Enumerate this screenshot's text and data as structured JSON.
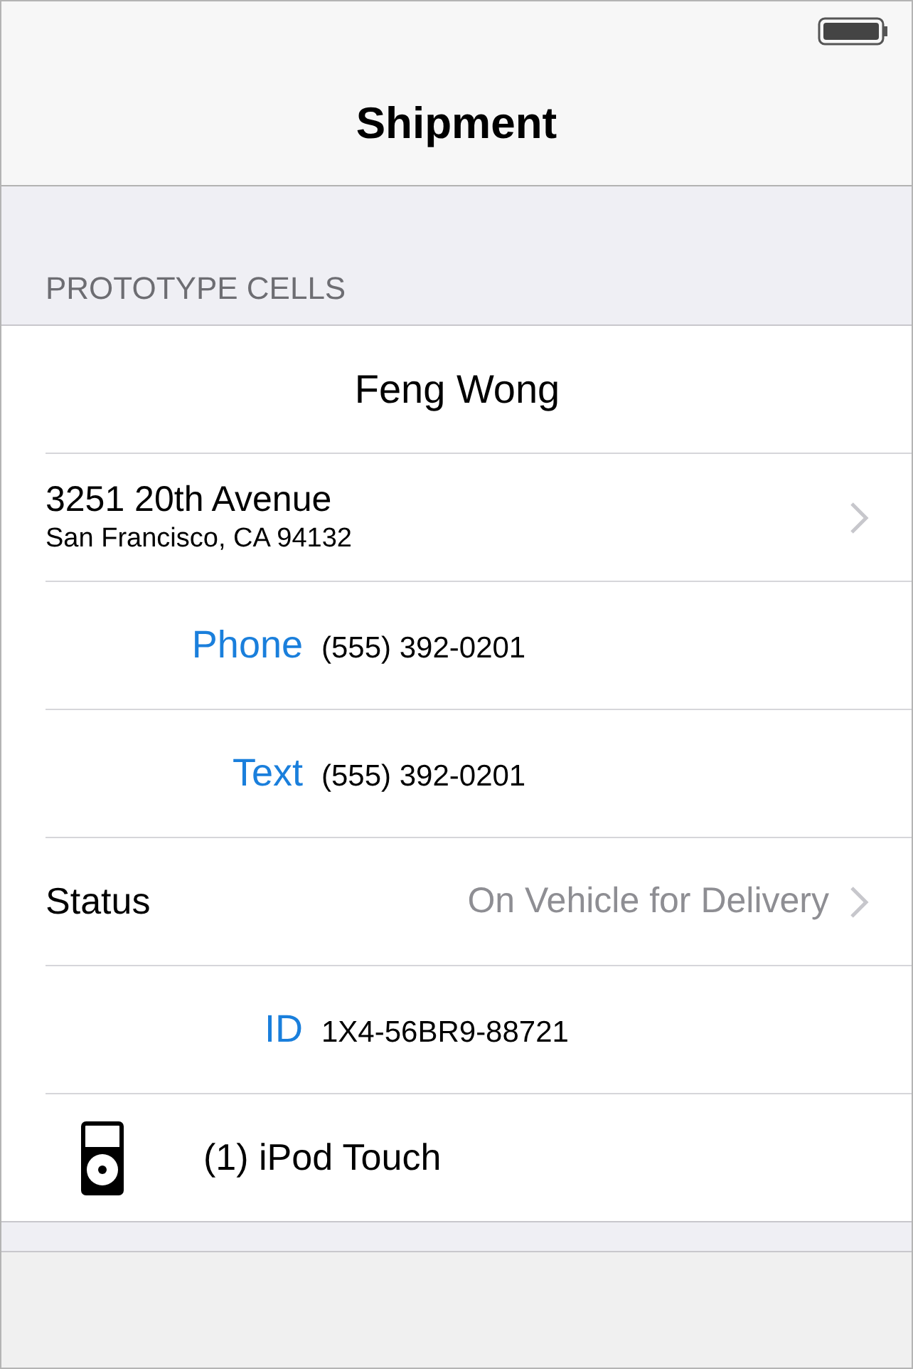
{
  "nav_bar": {
    "title": "Shipment"
  },
  "section": {
    "header": "PROTOTYPE CELLS"
  },
  "rows": [
    {
      "kind": "title",
      "text": "Feng Wong"
    },
    {
      "kind": "address",
      "line_1": "3251 20th Avenue",
      "line_2": "San Francisco, CA 94132",
      "disclosure": true
    },
    {
      "kind": "labeled",
      "label": "Phone",
      "value": "(555) 392-0201"
    },
    {
      "kind": "labeled",
      "label": "Text",
      "value": "(555) 392-0201"
    },
    {
      "kind": "status",
      "label": "Status",
      "value": "On Vehicle for Delivery",
      "disclosure": true
    },
    {
      "kind": "labeled",
      "label": "ID",
      "value": "1X4-56BR9-88721"
    },
    {
      "kind": "product",
      "text": "(1) iPod Touch"
    }
  ]
}
